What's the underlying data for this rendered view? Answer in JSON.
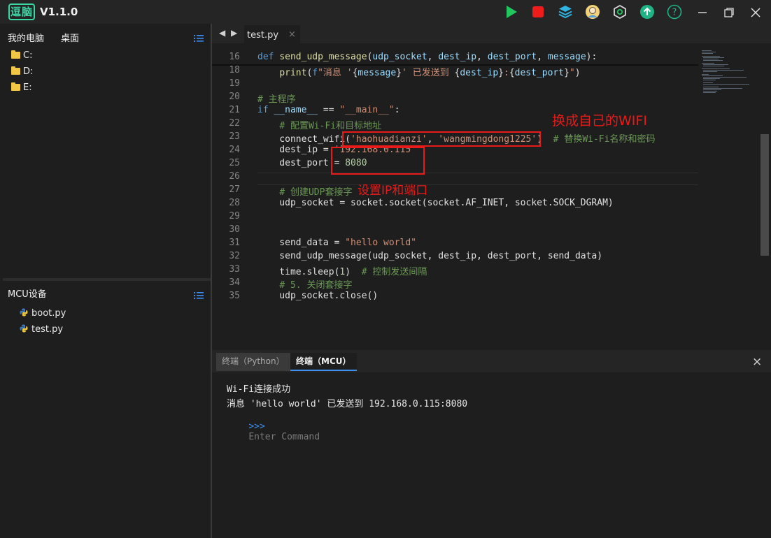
{
  "app": {
    "logo_text": "逗脑",
    "version": "V1.1.0"
  },
  "toolbar": {
    "icons": [
      "run-icon",
      "stop-icon",
      "layers-icon",
      "user-avatar-icon",
      "settings-hex-icon",
      "upload-icon",
      "help-icon"
    ],
    "colors": {
      "run": "#22c55e",
      "stop": "#ef1c1c",
      "accent": "#3c8ef0"
    }
  },
  "left_panel": {
    "tabs": [
      "我的电脑",
      "桌面"
    ],
    "drives": [
      "C:",
      "D:",
      "E:"
    ]
  },
  "mcu_panel": {
    "title": "MCU设备",
    "files": [
      "boot.py",
      "test.py"
    ]
  },
  "editor": {
    "tab_label": "test.py",
    "tab_close": "×",
    "lines": [
      {
        "n": "16",
        "tokens": [
          [
            "kw",
            "def "
          ],
          [
            "fn",
            "send_udp_message"
          ],
          [
            "pl",
            "("
          ],
          [
            "vr",
            "udp_socket"
          ],
          [
            "pl",
            ", "
          ],
          [
            "vr",
            "dest_ip"
          ],
          [
            "pl",
            ", "
          ],
          [
            "vr",
            "dest_port"
          ],
          [
            "pl",
            ", "
          ],
          [
            "vr",
            "message"
          ],
          [
            "pl",
            "):"
          ]
        ]
      },
      {
        "n": "18",
        "tokens": [
          [
            "pl",
            "    "
          ],
          [
            "fn",
            "print"
          ],
          [
            "pl",
            "("
          ],
          [
            "kw",
            "f"
          ],
          [
            "str",
            "\"消息 '"
          ],
          [
            "pl",
            "{"
          ],
          [
            "vr",
            "message"
          ],
          [
            "pl",
            "}"
          ],
          [
            "str",
            "' 已发送到 "
          ],
          [
            "pl",
            "{"
          ],
          [
            "vr",
            "dest_ip"
          ],
          [
            "pl",
            "}"
          ],
          [
            "str",
            ":"
          ],
          [
            "pl",
            "{"
          ],
          [
            "vr",
            "dest_port"
          ],
          [
            "pl",
            "}"
          ],
          [
            "str",
            "\""
          ],
          [
            "pl",
            ")"
          ]
        ]
      },
      {
        "n": "19",
        "tokens": []
      },
      {
        "n": "20",
        "tokens": [
          [
            "cm",
            "# 主程序"
          ]
        ]
      },
      {
        "n": "21",
        "tokens": [
          [
            "kw",
            "if "
          ],
          [
            "vr",
            "__name__"
          ],
          [
            "pl",
            " == "
          ],
          [
            "str",
            "\"__main__\""
          ],
          [
            "pl",
            ":"
          ]
        ]
      },
      {
        "n": "22",
        "tokens": [
          [
            "pl",
            "    "
          ],
          [
            "cm",
            "# 配置Wi-Fi和目标地址"
          ]
        ]
      },
      {
        "n": "23",
        "tokens": [
          [
            "pl",
            "    connect_wifi("
          ],
          [
            "str",
            "'haohuadianzi'"
          ],
          [
            "pl",
            ", "
          ],
          [
            "str",
            "'wangmingdong1225'"
          ],
          [
            "pl",
            ")  "
          ],
          [
            "cm",
            "# 替换Wi-Fi名称和密码"
          ]
        ]
      },
      {
        "n": "24",
        "tokens": [
          [
            "pl",
            "    dest_ip = "
          ],
          [
            "str",
            "'192.168.0.115'"
          ]
        ]
      },
      {
        "n": "25",
        "tokens": [
          [
            "pl",
            "    dest_port = "
          ],
          [
            "num",
            "8080"
          ]
        ]
      },
      {
        "n": "26",
        "tokens": []
      },
      {
        "n": "27",
        "tokens": [
          [
            "pl",
            "    "
          ],
          [
            "cm",
            "# 创建UDP套接字"
          ]
        ]
      },
      {
        "n": "28",
        "tokens": [
          [
            "pl",
            "    udp_socket = socket.socket(socket.AF_INET, socket.SOCK_DGRAM)"
          ]
        ]
      },
      {
        "n": "29",
        "tokens": []
      },
      {
        "n": "30",
        "tokens": []
      },
      {
        "n": "31",
        "tokens": [
          [
            "pl",
            "    send_data = "
          ],
          [
            "str",
            "\"hello world\""
          ]
        ]
      },
      {
        "n": "32",
        "tokens": [
          [
            "pl",
            "    send_udp_message(udp_socket, dest_ip, dest_port, send_data)"
          ]
        ]
      },
      {
        "n": "33",
        "tokens": [
          [
            "pl",
            "    time.sleep("
          ],
          [
            "num",
            "1"
          ],
          [
            "pl",
            ")  "
          ],
          [
            "cm",
            "# 控制发送间隔"
          ]
        ]
      },
      {
        "n": "34",
        "tokens": [
          [
            "pl",
            "    "
          ],
          [
            "cm",
            "# 5. 关闭套接字"
          ]
        ]
      },
      {
        "n": "35",
        "tokens": [
          [
            "pl",
            "    udp_socket.close()"
          ]
        ]
      }
    ]
  },
  "annotations": {
    "wifi_note": "换成自己的WIFI",
    "ip_note": "设置IP和端口",
    "color": "#e81a1a"
  },
  "terminal": {
    "tabs": [
      "终端（Python）",
      "终端（MCU）"
    ],
    "close": "×",
    "output": [
      "Wi-Fi连接成功",
      "消息 'hello world' 已发送到 192.168.0.115:8080"
    ],
    "prompt_symbol": ">>>",
    "placeholder": "Enter Command"
  }
}
